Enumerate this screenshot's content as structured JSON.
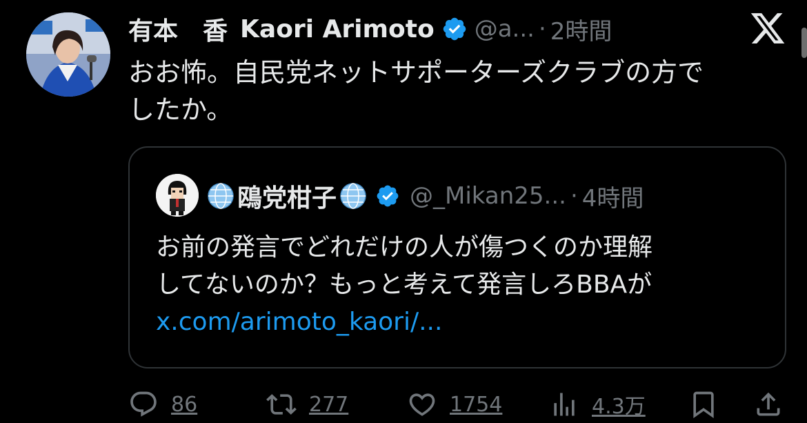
{
  "tweet": {
    "display_name": "有本　香",
    "display_name_en": "Kaori Arimoto",
    "handle": "@a...",
    "separator": "·",
    "time": "2時間",
    "text_line1": "おお怖。自民党ネットサポーターズクラブの方で",
    "text_line2": "したか。"
  },
  "quote": {
    "name": "鴎党柑子",
    "handle": "@_Mikan25...",
    "separator": "·",
    "time": "4時間",
    "text_line1": "お前の発言でどれだけの人が傷つくのか理解",
    "text_line2": "してないのか？もっと考えて発言しろBBAが",
    "link": "x.com/arimoto_kaori/..."
  },
  "actions": {
    "replies": "86",
    "retweets": "277",
    "likes": "1754",
    "views": "4.3万"
  },
  "colors": {
    "background": "#000000",
    "text_primary": "#e7e9ea",
    "text_secondary": "#71767b",
    "link": "#1d9bf0",
    "verified": "#1d9bf0",
    "border": "#2f3336"
  },
  "icons": {
    "verified": "verified-badge-icon",
    "x_logo": "x-logo-icon",
    "globe": "globe-icon",
    "reply": "reply-icon",
    "retweet": "retweet-icon",
    "like": "heart-icon",
    "views": "views-chart-icon",
    "bookmark": "bookmark-icon",
    "share": "share-icon"
  }
}
